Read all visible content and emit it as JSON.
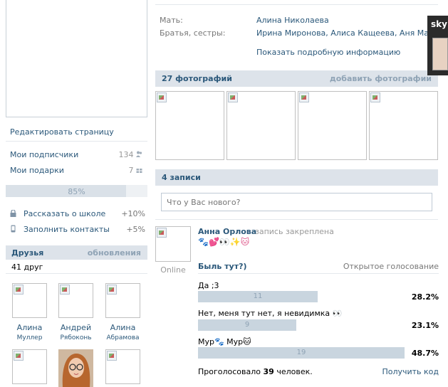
{
  "left": {
    "edit_page": "Редактировать страницу",
    "subscribers_label": "Мои подписчики",
    "subscribers_count": "134",
    "gifts_label": "Мои подарки",
    "gifts_count": "7",
    "progress_text": "85%",
    "progress_value": 0.85,
    "tasks": [
      {
        "label": "Рассказать о школе",
        "value": "+10%"
      },
      {
        "label": "Заполнить контакты",
        "value": "+5%"
      }
    ],
    "friends_title": "Друзья",
    "friends_updates": "обновления",
    "friends_count": "41 друг",
    "friends": [
      {
        "first": "Алина",
        "last": "Муллер"
      },
      {
        "first": "Андрей",
        "last": "Рябоконь"
      },
      {
        "first": "Алина",
        "last": "Абрамова"
      }
    ]
  },
  "info": {
    "mother_label": "Мать:",
    "mother_value": "Алина Николаева",
    "siblings_label": "Братья, сестры:",
    "siblings_value": "Ирина Миронова, Алиса Кащеева, Аня Малфой",
    "show_more": "Показать подробную информацию"
  },
  "photos": {
    "title": "27 фотографий",
    "add": "добавить фотографии"
  },
  "wall": {
    "title": "4 записи",
    "placeholder": "Что у Вас нового?",
    "post_author": "Анна Орлова",
    "post_status": "запись закреплена",
    "post_emoji": "🐾💕👀✨🐱",
    "online": "Online",
    "poll_question": "Быль тут?)",
    "poll_type": "Открытое голосование",
    "options": [
      {
        "text": "Да ;3",
        "count": "11",
        "percent": "28.2%",
        "fraction": 0.282
      },
      {
        "text": "Нет, меня тут нет, я невидимка 👀",
        "count": "9",
        "percent": "23.1%",
        "fraction": 0.231
      },
      {
        "text": "Мур🐾 Мур🐱",
        "count": "19",
        "percent": "48.7%",
        "fraction": 0.487
      }
    ],
    "voted_prefix": "Проголосовало",
    "voted_count": "39",
    "voted_suffix": "человек.",
    "get_code": "Получить код"
  },
  "skype": {
    "label": "sky"
  }
}
